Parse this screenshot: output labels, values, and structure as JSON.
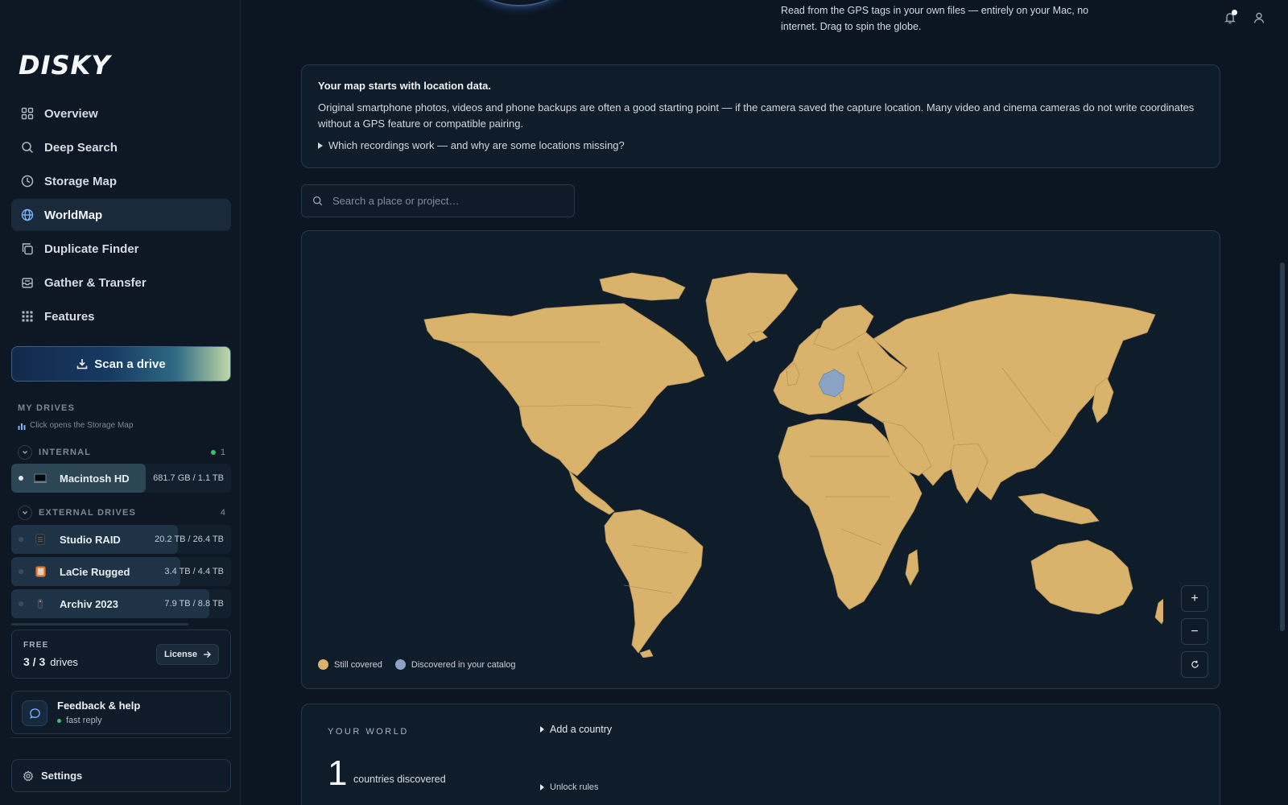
{
  "app": {
    "logo": "DISKY"
  },
  "sidebar": {
    "nav": [
      {
        "label": "Overview",
        "icon": "grid-icon"
      },
      {
        "label": "Deep Search",
        "icon": "search-icon"
      },
      {
        "label": "Storage Map",
        "icon": "clock-icon"
      },
      {
        "label": "WorldMap",
        "icon": "globe-icon",
        "active": true
      },
      {
        "label": "Duplicate Finder",
        "icon": "copy-icon"
      },
      {
        "label": "Gather & Transfer",
        "icon": "tray-icon"
      },
      {
        "label": "Features",
        "icon": "apps-icon"
      }
    ],
    "scan_button": "Scan a drive",
    "my_drives_label": "MY DRIVES",
    "hint": "Click opens the Storage Map",
    "internal": {
      "label": "INTERNAL",
      "count": "1",
      "drives": [
        {
          "name": "Macintosh HD",
          "size": "681.7 GB / 1.1 TB",
          "used_fraction": 0.61
        }
      ]
    },
    "external": {
      "label": "EXTERNAL DRIVES",
      "count": "4",
      "drives": [
        {
          "name": "Studio RAID",
          "size": "20.2 TB / 26.4 TB",
          "used_fraction": 0.76
        },
        {
          "name": "LaCie Rugged",
          "size": "3.4 TB / 4.4 TB",
          "used_fraction": 0.77
        },
        {
          "name": "Archiv 2023",
          "size": "7.9 TB / 8.8 TB",
          "used_fraction": 0.9
        }
      ]
    },
    "license": {
      "plan": "FREE",
      "count": "3 / 3",
      "unit": "drives",
      "button": "License"
    },
    "feedback": {
      "title": "Feedback & help",
      "subtitle": "fast reply"
    },
    "settings": "Settings"
  },
  "header": {
    "intro": "Read from the GPS tags in your own files — entirely on your Mac, no internet. Drag to spin the globe."
  },
  "info": {
    "title": "Your map starts with location data.",
    "body": "Original smartphone photos, videos and phone backups are often a good starting point — if the camera saved the capture location. Many video and cinema cameras do not write coordinates without a GPS feature or compatible pairing.",
    "toggle": "Which recordings work — and why are some locations missing?"
  },
  "search": {
    "placeholder": "Search a place or project…"
  },
  "map": {
    "legend": [
      {
        "label": "Still covered",
        "color": "#d9b36c"
      },
      {
        "label": "Discovered in your catalog",
        "color": "#8aa3c4"
      }
    ],
    "zoom_in": "+",
    "zoom_out": "−"
  },
  "world": {
    "label": "YOUR WORLD",
    "count": "1",
    "unit": "countries discovered",
    "add_country": "Add a country",
    "unlock_rules": "Unlock rules"
  }
}
